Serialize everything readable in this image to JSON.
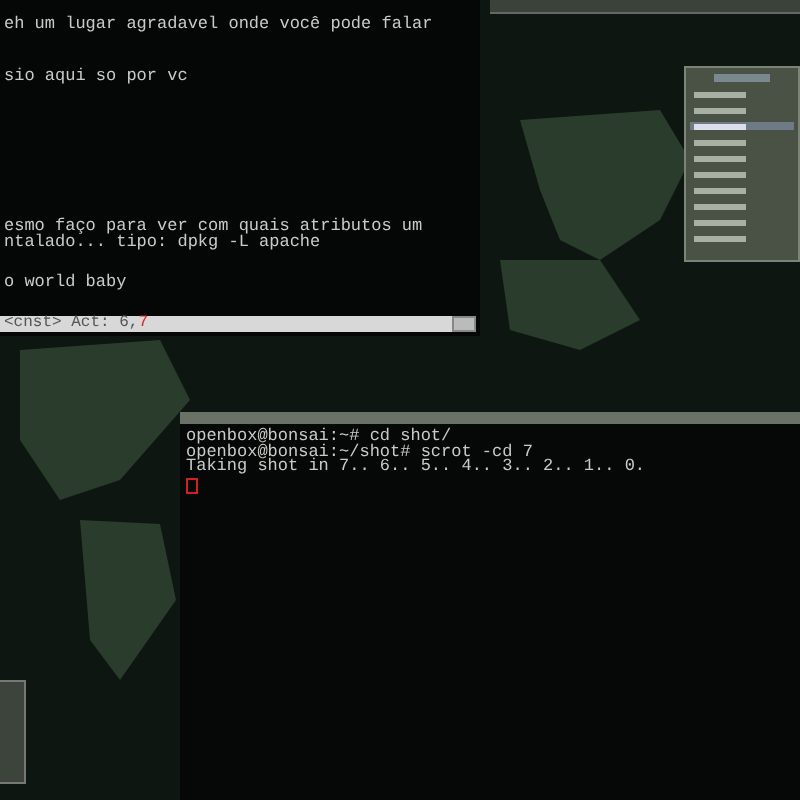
{
  "top_terminal": {
    "lines": [
      "eh um lugar agradavel onde você pode falar",
      "sio aqui so por vc",
      "esmo faço para ver com quais atributos um",
      "ntalado... tipo: dpkg -L apache",
      "o world baby"
    ],
    "status": "<cnst> Act: 6,",
    "status_cursor": "7"
  },
  "menu": {
    "items": [
      {
        "selected": false
      },
      {
        "selected": false
      },
      {
        "selected": true
      },
      {
        "selected": false
      },
      {
        "selected": false
      },
      {
        "selected": false
      },
      {
        "selected": false
      },
      {
        "selected": false
      },
      {
        "selected": false
      },
      {
        "selected": false
      }
    ]
  },
  "bottom_terminal": {
    "lines": [
      "openbox@bonsai:~# cd shot/",
      "openbox@bonsai:~/shot# scrot -cd 7",
      "Taking shot in 7.. 6.. 5.. 4.. 3.. 2.. 1.. 0."
    ],
    "cursor": true
  }
}
